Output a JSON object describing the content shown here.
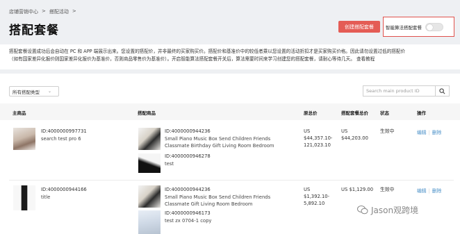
{
  "breadcrumb": [
    "店铺营销中心",
    ">",
    "搭配活动",
    ">"
  ],
  "page_title": "搭配套餐",
  "create_button": "创建搭配套餐",
  "smart_toggle_label": "智能算法搭配套餐",
  "smart_toggle_on": false,
  "notice": {
    "line1": "搭配套餐设置成功后会自动在 PC 和 APP 端展示出来。您设置的搭配价，并非最终的买家购买价。搭配价和基准价中的较低者乘以您设置的活动折扣才是买家购买价格。因此请勿设置过低的搭配价",
    "line2": "（如有国家差异化报价则国家差异化报价为基准价，否则商品零售价为基准价）。开启智能算法搭配套餐开关后，算法需要时间来学习创建您的搭配套餐，请耐心等待几天。",
    "link": "查看教程"
  },
  "filter": {
    "selected": "所有搭配类型"
  },
  "search": {
    "placeholder": "Search main product ID"
  },
  "columns": {
    "main": "主商品",
    "bundle": "搭配商品",
    "original": "原总价",
    "bundle_price": "搭配套餐总价",
    "status": "状态",
    "actions": "操作"
  },
  "rows": [
    {
      "main_id": "ID:4000000997731",
      "main_title": "search test pro 6",
      "items": [
        {
          "id": "ID:4000000944236",
          "title1": "Small Piano Music Box Send Children Friends",
          "title2": "Classmate Birthday Gift Living Room Bedroom"
        },
        {
          "id": "ID:4000000946278",
          "title1": "test"
        }
      ],
      "original_1": "US",
      "original_2": "$44,357.10-",
      "original_3": "121,023.10",
      "bundle_1": "US",
      "bundle_2": "$44,203.00",
      "status": "生效中",
      "edit": "编辑",
      "delete": "删除"
    },
    {
      "main_id": "ID:4000000944166",
      "main_title": "title",
      "items": [
        {
          "id": "ID:4000000944236",
          "title1": "Small Piano Music Box Send Children Friends",
          "title2": "Classmate Gift Living Room Bedroom"
        },
        {
          "id": "ID:4000000946173",
          "title1": "test zx 0704-1 copy"
        }
      ],
      "original_1": "US",
      "original_2": "$1,392.10-",
      "original_3": "5,892.10",
      "bundle_1": "US $1,129.00",
      "status": "生效中",
      "edit": "编辑",
      "delete": "删除"
    }
  ],
  "watermark": "Jason观跨境"
}
